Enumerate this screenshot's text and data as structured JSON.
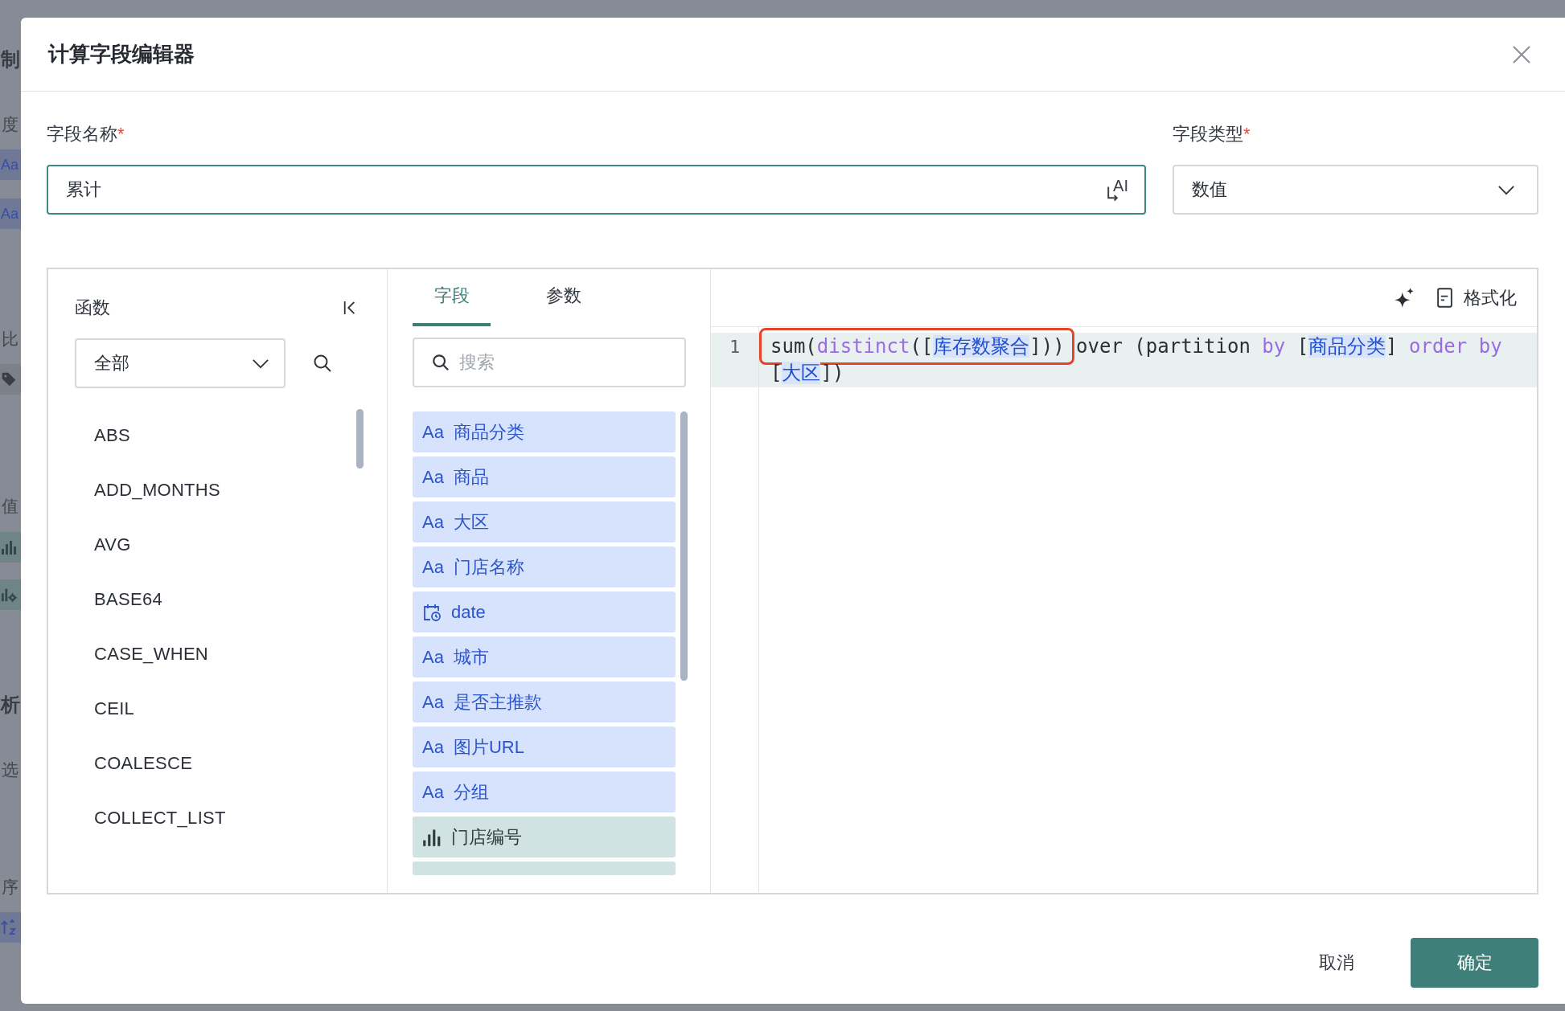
{
  "background_panel": {
    "items": [
      {
        "kind": "heading",
        "text": "制"
      },
      {
        "kind": "label",
        "text": "度"
      },
      {
        "kind": "field",
        "text": "Aa"
      },
      {
        "kind": "field",
        "text": "Aa"
      },
      {
        "kind": "label",
        "text": "比"
      },
      {
        "kind": "tag"
      },
      {
        "kind": "label",
        "text": "值"
      },
      {
        "kind": "measure"
      },
      {
        "kind": "measure-setting"
      },
      {
        "kind": "heading",
        "text": "析"
      },
      {
        "kind": "label",
        "text": "选"
      },
      {
        "kind": "label",
        "text": "序"
      },
      {
        "kind": "sort"
      }
    ]
  },
  "dialog": {
    "title": "计算字段编辑器",
    "field_name": {
      "label": "字段名称",
      "required_mark": "*",
      "value": "累计",
      "ai_button": "AI"
    },
    "field_type": {
      "label": "字段类型",
      "required_mark": "*",
      "value": "数值"
    },
    "functions": {
      "title": "函数",
      "category": "全部",
      "items": [
        "ABS",
        "ADD_MONTHS",
        "AVG",
        "BASE64",
        "CASE_WHEN",
        "CEIL",
        "COALESCE",
        "COLLECT_LIST"
      ]
    },
    "fields": {
      "tabs": [
        {
          "label": "字段",
          "selected": true
        },
        {
          "label": "参数",
          "selected": false
        }
      ],
      "search": {
        "placeholder": "搜索"
      },
      "items": [
        {
          "kind": "text",
          "type_label": "Aa",
          "name": "商品分类",
          "cut_off": false
        },
        {
          "kind": "text",
          "type_label": "Aa",
          "name": "商品",
          "cut_off": false
        },
        {
          "kind": "text",
          "type_label": "Aa",
          "name": "大区",
          "cut_off": false
        },
        {
          "kind": "text",
          "type_label": "Aa",
          "name": "门店名称",
          "cut_off": false
        },
        {
          "kind": "date",
          "name": "date",
          "cut_off": false
        },
        {
          "kind": "text",
          "type_label": "Aa",
          "name": "城市",
          "cut_off": false
        },
        {
          "kind": "text",
          "type_label": "Aa",
          "name": "是否主推款",
          "cut_off": false
        },
        {
          "kind": "text",
          "type_label": "Aa",
          "name": "图片URL",
          "cut_off": false
        },
        {
          "kind": "text",
          "type_label": "Aa",
          "name": "分组",
          "cut_off": false
        },
        {
          "kind": "measure",
          "name": "门店编号",
          "cut_off": false
        },
        {
          "kind": "measure",
          "cut_off": true
        }
      ]
    },
    "editor": {
      "format_button": "格式化",
      "lines": [
        {
          "number": "1",
          "current": true,
          "segments": [
            {
              "marked": true,
              "tokens": [
                {
                  "kind": "plain",
                  "text": "sum("
                },
                {
                  "kind": "keyword",
                  "text": "distinct"
                },
                {
                  "kind": "plain",
                  "text": "(["
                },
                {
                  "kind": "field",
                  "text": "库存数聚合"
                },
                {
                  "kind": "plain",
                  "text": "]))"
                }
              ]
            },
            {
              "marked": false,
              "tokens": [
                {
                  "kind": "plain",
                  "text": " over (partition "
                },
                {
                  "kind": "keyword",
                  "text": "by"
                },
                {
                  "kind": "plain",
                  "text": " ["
                },
                {
                  "kind": "field",
                  "text": "商品分类"
                },
                {
                  "kind": "plain",
                  "text": "] "
                },
                {
                  "kind": "keyword",
                  "text": "order by"
                },
                {
                  "kind": "plain",
                  "text": " ["
                },
                {
                  "kind": "field",
                  "text": "大区"
                },
                {
                  "kind": "plain",
                  "text": "])"
                }
              ]
            }
          ]
        }
      ]
    },
    "buttons": [
      {
        "kind": "cancel",
        "label": "取消"
      },
      {
        "kind": "confirm",
        "label": "确定"
      }
    ]
  }
}
